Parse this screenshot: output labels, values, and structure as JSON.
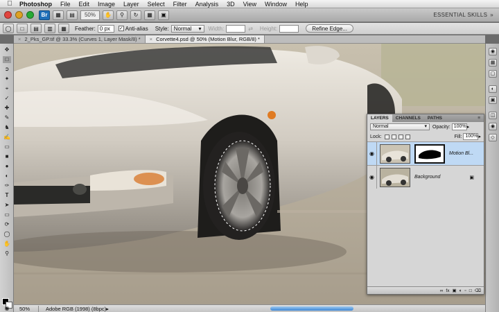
{
  "menu_bar": {
    "app_name": "Photoshop",
    "items": [
      "File",
      "Edit",
      "Image",
      "Layer",
      "Select",
      "Filter",
      "Analysis",
      "3D",
      "View",
      "Window",
      "Help"
    ]
  },
  "app_bar": {
    "bridge_label": "Br",
    "zoom": "50%",
    "workspace_label": "ESSENTIAL SKILLS"
  },
  "options_bar": {
    "feather_label": "Feather:",
    "feather_value": "0 px",
    "anti_alias_label": "Anti-alias",
    "style_label": "Style:",
    "style_value": "Normal",
    "width_label": "Width:",
    "height_label": "Height:",
    "refine_edge_label": "Refine Edge..."
  },
  "document_tabs": [
    {
      "label": "2_Pks_GP.tif @ 33.3% (Curves 1, Layer Mask/8) *"
    },
    {
      "label": "Corvette4.psd @ 50% (Motion Blur, RGB/8) *"
    }
  ],
  "status_bar": {
    "zoom": "50%",
    "doc_info": "Adobe RGB (1998) (8bpc)"
  },
  "layers_panel": {
    "tabs": [
      "LAYERS",
      "CHANNELS",
      "PATHS"
    ],
    "blend_mode": "Normal",
    "opacity_label": "Opacity:",
    "opacity_value": "100%",
    "lock_label": "Lock:",
    "fill_label": "Fill:",
    "fill_value": "100%",
    "layers": [
      {
        "name": "Motion Bl...",
        "selected": true
      },
      {
        "name": "Background",
        "selected": false
      }
    ]
  },
  "colors": {
    "accent_blue": "#3c86d6",
    "selected_layer": "#bfd9f4",
    "foreground": "#000000",
    "background": "#ffffff"
  }
}
